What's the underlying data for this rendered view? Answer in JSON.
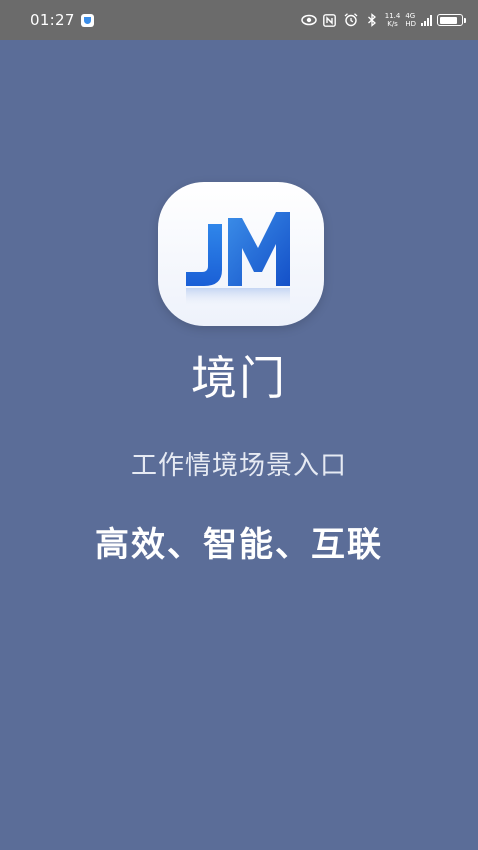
{
  "status_bar": {
    "time": "01:27",
    "network_speed_value": "11.4",
    "network_speed_unit": "K/s",
    "network_generation": "4G",
    "network_hd": "HD",
    "icons": [
      "shield-icon",
      "eye-icon",
      "nfc-icon",
      "alarm-icon",
      "bluetooth-icon",
      "signal-icon",
      "battery-icon"
    ],
    "battery_level": 0.85
  },
  "splash": {
    "logo_text": "JM",
    "app_name": "境门",
    "tagline": "工作情境场景入口",
    "slogan": "高效、智能、互联"
  },
  "colors": {
    "background": "#5b6d98",
    "status_bar": "#6b6b6b",
    "logo_blue": "#1a5fd6",
    "logo_light_blue": "#3b8de8"
  }
}
